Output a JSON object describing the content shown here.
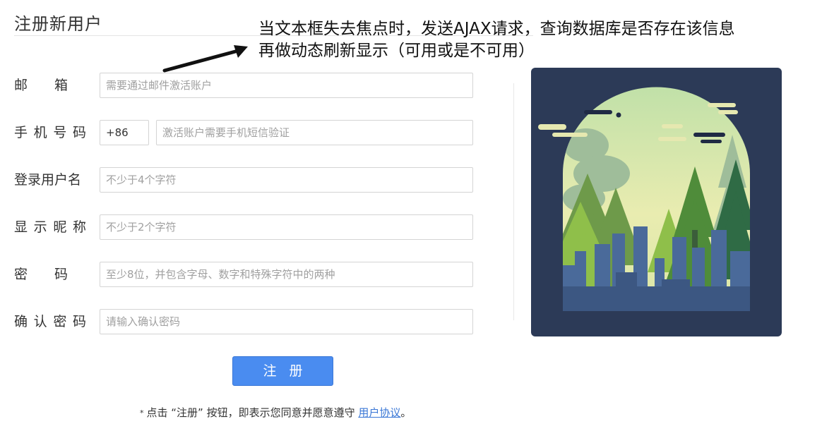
{
  "page": {
    "title": "注册新用户"
  },
  "annotation": {
    "line1": "当文本框失去焦点时，发送AJAX请求，查询数据库是否存在该信息",
    "line2": "再做动态刷新显示（可用或是不可用）"
  },
  "form": {
    "email": {
      "label": "邮　　箱",
      "placeholder": "需要通过邮件激活账户"
    },
    "phone": {
      "label": "手机号码",
      "country_code": "+86",
      "placeholder": "激活账户需要手机短信验证"
    },
    "username": {
      "label": "登录用户名",
      "placeholder": "不少于4个字符"
    },
    "nickname": {
      "label": "显示昵称",
      "placeholder": "不少于2个字符"
    },
    "password": {
      "label": "密　　码",
      "placeholder": "至少8位，并包含字母、数字和特殊字符中的两种"
    },
    "confirm": {
      "label": "确认密码",
      "placeholder": "请输入确认密码"
    },
    "submit_label": "注册"
  },
  "agreement": {
    "star": "*",
    "text": "点击 “注册” 按钮，即表示您同意并愿意遵守 ",
    "link": "用户协议",
    "suffix": "。"
  },
  "colors": {
    "accent": "#4a8cf0",
    "illustration_bg": "#2c3a57"
  }
}
